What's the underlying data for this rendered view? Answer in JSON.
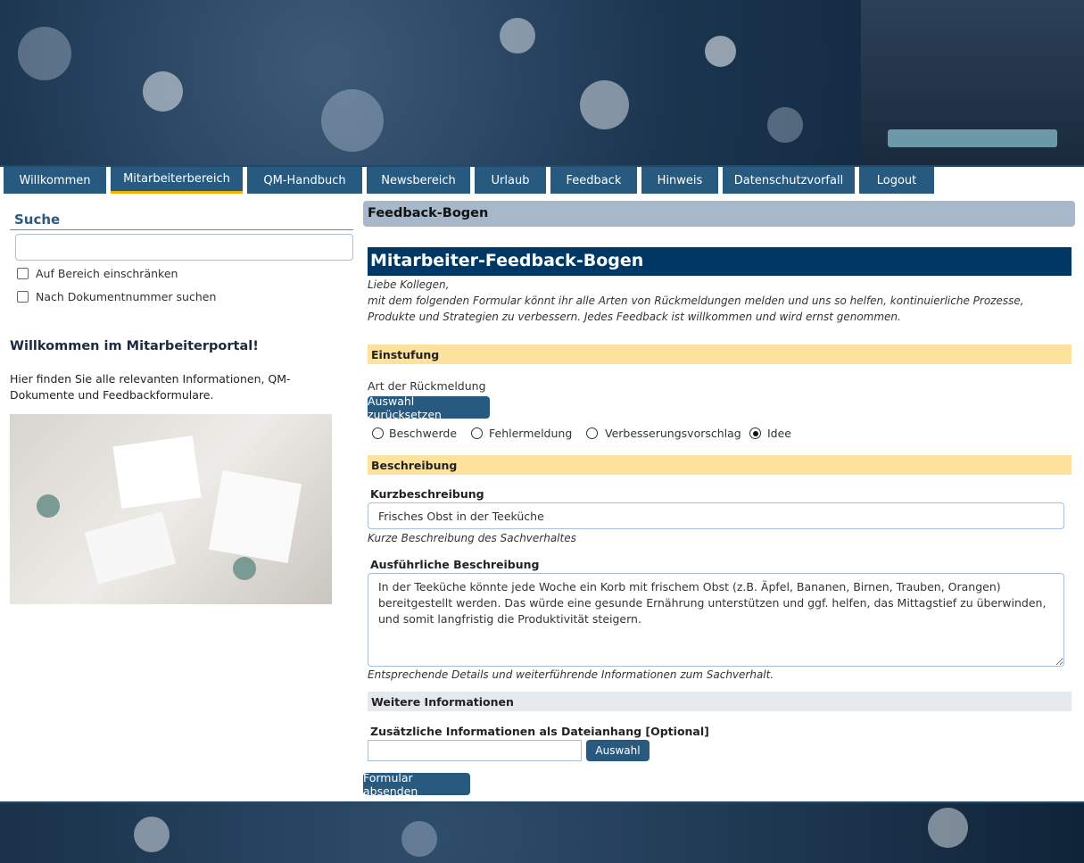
{
  "nav": {
    "items": [
      {
        "label": "Willkommen",
        "active": false
      },
      {
        "label": "Mitarbeiterbereich",
        "active": true
      },
      {
        "label": "QM-Handbuch",
        "active": false
      },
      {
        "label": "Newsbereich",
        "active": false
      },
      {
        "label": "Urlaub",
        "active": false
      },
      {
        "label": "Feedback",
        "active": false
      },
      {
        "label": "Hinweis",
        "active": false
      },
      {
        "label": "Datenschutzvorfall",
        "active": false
      },
      {
        "label": "Logout",
        "active": false
      }
    ]
  },
  "sidebar": {
    "search_title": "Suche",
    "search_value": "",
    "checkbox_area": "Auf Bereich einschränken",
    "checkbox_docnum": "Nach Dokumentnummer suchen",
    "welcome_title": "Willkommen im Mitarbeiterportal!",
    "welcome_text": "Hier finden Sie alle relevanten Informationen, QM-Dokumente und Feedbackformulare."
  },
  "main": {
    "page_title": "Feedback-Bogen",
    "form_title": "Mitarbeiter-Feedback-Bogen",
    "intro_greeting": "Liebe Kollegen,",
    "intro_text": "mit dem folgenden Formular könnt ihr alle Arten von Rückmeldungen melden und uns so helfen, kontinuierliche Prozesse, Produkte und Strategien zu verbessern. Jedes Feedback ist willkommen und wird ernst genommen.",
    "section_einstufung": "Einstufung",
    "art_label": "Art der Rückmeldung",
    "reset_button": "Auswahl zurücksetzen",
    "radios": [
      {
        "label": "Beschwerde",
        "checked": false
      },
      {
        "label": "Fehlermeldung",
        "checked": false
      },
      {
        "label": "Verbesserungsvorschlag",
        "checked": false
      },
      {
        "label": "Idee",
        "checked": true
      }
    ],
    "section_beschreibung": "Beschreibung",
    "kurz_label": "Kurzbeschreibung",
    "kurz_value": "Frisches Obst in der Teeküche",
    "kurz_hint": "Kurze Beschreibung des Sachverhaltes",
    "lang_label": "Ausführliche Beschreibung",
    "lang_value": "In der Teeküche könnte jede Woche ein Korb mit frischem Obst (z.B. Äpfel, Bananen, Birnen, Trauben, Orangen) bereitgestellt werden. Das würde eine gesunde Ernährung unterstützen und ggf. helfen, das Mittagstief zu überwinden, und somit langfristig die Produktivität steigern.",
    "lang_hint": "Entsprechende Details und weiterführende Informationen zum Sachverhalt.",
    "section_weitere": "Weitere Informationen",
    "file_label": "Zusätzliche Informationen als Dateianhang [Optional]",
    "file_value": "",
    "file_button": "Auswahl",
    "submit_button": "Formular absenden"
  },
  "colors": {
    "nav": "#285a80",
    "active_tab_underline": "#f0b400",
    "form_title_bg": "#003865",
    "section_bg": "#fde29e",
    "page_title_bg": "#a6b8c9",
    "weitere_bg": "#e6e9ec"
  }
}
